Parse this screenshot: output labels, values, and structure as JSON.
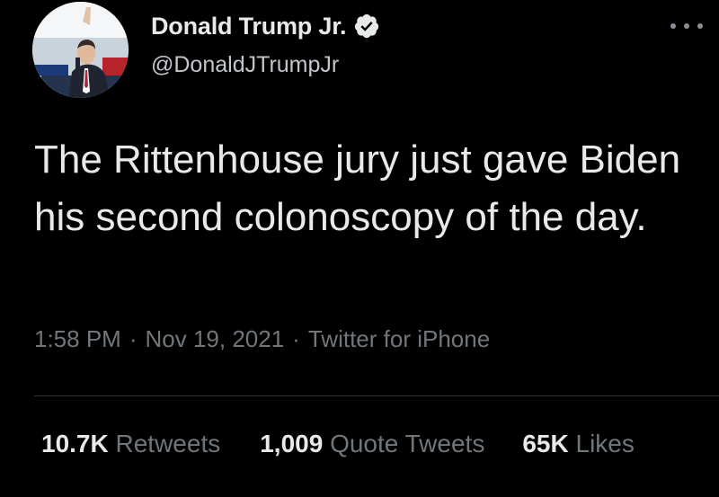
{
  "author": {
    "display_name": "Donald Trump Jr.",
    "handle": "@DonaldJTrumpJr",
    "verified": true
  },
  "tweet": {
    "text": "The Rittenhouse jury just gave Biden his second colonoscopy of the day.",
    "time": "1:58 PM",
    "date": "Nov 19, 2021",
    "source": "Twitter for iPhone",
    "separator": "·"
  },
  "stats": {
    "retweets_count": "10.7K",
    "retweets_label": "Retweets",
    "quotes_count": "1,009",
    "quotes_label": "Quote Tweets",
    "likes_count": "65K",
    "likes_label": "Likes"
  },
  "icons": {
    "verified_badge": "verified-badge-icon",
    "more": "more-options-icon"
  },
  "colors": {
    "background": "#000000",
    "primary_text": "#e7e9ea",
    "secondary_text": "#71767b",
    "divider": "#2f3336"
  }
}
